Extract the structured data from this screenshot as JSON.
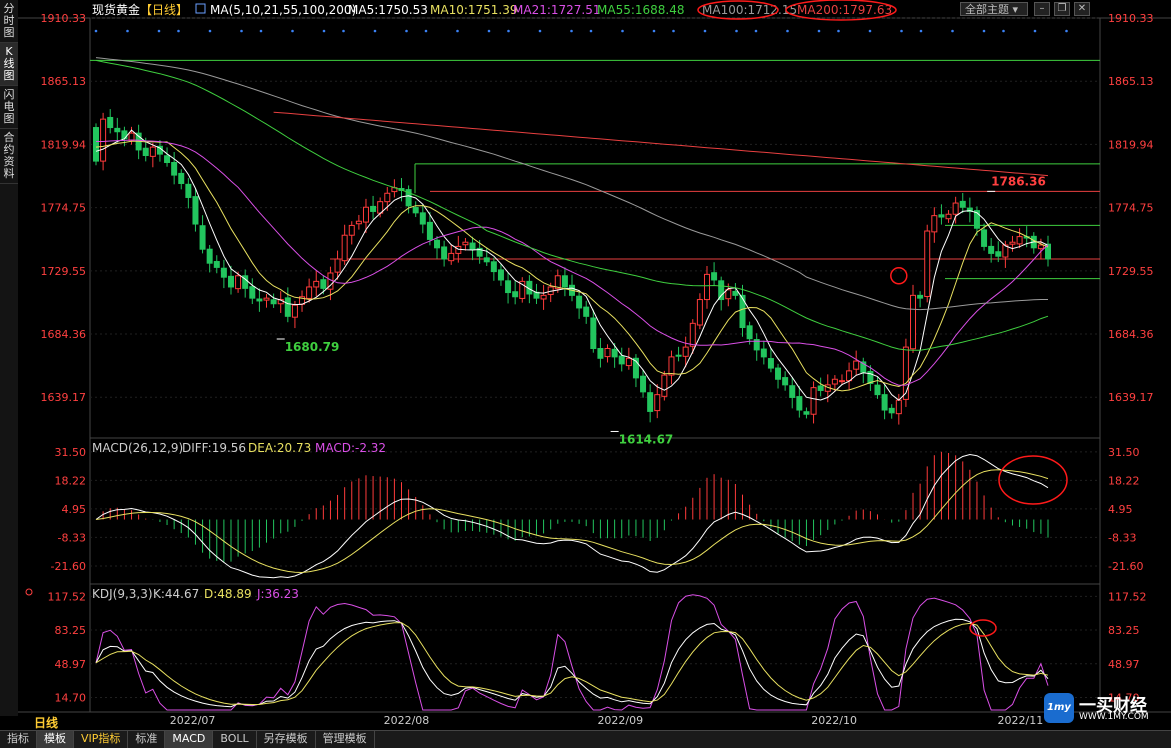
{
  "window": {
    "symbol": "现货黄金",
    "period_tag": "【日线】",
    "topic_button": "全部主题",
    "period_footer": "日线"
  },
  "left_tabs": [
    "分时图",
    "K线图",
    "闪电图",
    "合约资料"
  ],
  "bottom_tabs": [
    "指标",
    "模板",
    "VIP指标",
    "标准",
    "MACD",
    "BOLL",
    "另存模板",
    "管理模板"
  ],
  "logo": {
    "badge": "1my",
    "name": "一买财经",
    "url": "WWW.1MY.COM"
  },
  "colors": {
    "bg": "#000000",
    "up": "#ff3b3b",
    "down": "#22c55e",
    "ma5": "#ffffff",
    "ma10": "#e8e060",
    "ma21": "#d94fe6",
    "ma55": "#3fcf3f",
    "ma100": "#9a9a9a",
    "ma200": "#e84040",
    "axis_text": "#ff4040",
    "grid": "#202020",
    "highlight": "#ff1a1a"
  },
  "chart_data": [
    {
      "type": "candlestick",
      "panel": "price",
      "legend_prefix": "MA(5,10,21,55,100,200)",
      "ma_legend": [
        {
          "label": "MA5:1750.53",
          "color": "#ffffff"
        },
        {
          "label": "MA10:1751.39",
          "color": "#e8e060"
        },
        {
          "label": "MA21:1727.51",
          "color": "#d94fe6"
        },
        {
          "label": "MA55:1688.48",
          "color": "#3fcf3f"
        },
        {
          "label": "MA100:1712.15",
          "color": "#9a9a9a"
        },
        {
          "label": "MA200:1797.63",
          "color": "#e84040"
        }
      ],
      "y_ticks": [
        "1910.33",
        "1865.13",
        "1819.94",
        "1774.75",
        "1729.55",
        "1684.36",
        "1639.17"
      ],
      "ylim": [
        1610,
        1910.33
      ],
      "x_ticks": [
        "2022/07",
        "2022/08",
        "2022/09",
        "2022/10",
        "2022/11"
      ],
      "annotations": [
        {
          "label": "1680.79",
          "value": 1680.79,
          "color": "#3fcf3f"
        },
        {
          "label": "1614.67",
          "value": 1614.67,
          "color": "#3fcf3f"
        },
        {
          "label": "1786.36",
          "value": 1786.36,
          "color": "#ff4040"
        }
      ],
      "closes": [
        1808,
        1838,
        1832,
        1829,
        1824,
        1828,
        1816,
        1812,
        1818,
        1813,
        1807,
        1798,
        1792,
        1782,
        1763,
        1745,
        1735,
        1732,
        1725,
        1718,
        1726,
        1717,
        1710,
        1708,
        1710,
        1706,
        1709,
        1697,
        1705,
        1711,
        1718,
        1722,
        1717,
        1728,
        1738,
        1755,
        1762,
        1765,
        1775,
        1772,
        1779,
        1785,
        1789,
        1787,
        1776,
        1771,
        1763,
        1752,
        1746,
        1738,
        1742,
        1747,
        1750,
        1745,
        1740,
        1736,
        1729,
        1723,
        1714,
        1711,
        1722,
        1713,
        1710,
        1712,
        1718,
        1726,
        1718,
        1712,
        1703,
        1697,
        1674,
        1667,
        1674,
        1668,
        1663,
        1667,
        1653,
        1643,
        1629,
        1641,
        1655,
        1668,
        1669,
        1675,
        1692,
        1709,
        1727,
        1723,
        1709,
        1716,
        1712,
        1689,
        1681,
        1673,
        1668,
        1660,
        1652,
        1648,
        1639,
        1630,
        1627,
        1646,
        1644,
        1648,
        1652,
        1651,
        1658,
        1665,
        1657,
        1649,
        1641,
        1630,
        1628,
        1637,
        1675,
        1712,
        1710,
        1758,
        1769,
        1768,
        1770,
        1778,
        1775,
        1772,
        1760,
        1747,
        1742,
        1740,
        1748,
        1750,
        1754,
        1753,
        1746,
        1748,
        1738
      ],
      "ma_end_values": {
        "MA5": 1750.53,
        "MA10": 1751.39,
        "MA21": 1727.51,
        "MA55": 1688.48,
        "MA100": 1712.15,
        "MA200": 1797.63
      },
      "horizontal_lines": [
        1880,
        1806,
        1786.36,
        1762,
        1738,
        1724
      ]
    },
    {
      "type": "bar+line",
      "panel": "macd",
      "legend": [
        {
          "label": "MACD(26,12,9)",
          "color": "#cccccc"
        },
        {
          "label": "DIFF:19.56",
          "color": "#cccccc"
        },
        {
          "label": "DEA:20.73",
          "color": "#e8e060"
        },
        {
          "label": "MACD:-2.32",
          "color": "#d94fe6"
        }
      ],
      "y_ticks": [
        "31.50",
        "18.22",
        "4.95",
        "-8.33",
        "-21.60"
      ],
      "ylim": [
        -30,
        37
      ]
    },
    {
      "type": "line",
      "panel": "kdj",
      "legend": [
        {
          "label": "KDJ(9,3,3)",
          "color": "#cccccc"
        },
        {
          "label": "K:44.67",
          "color": "#cccccc"
        },
        {
          "label": "D:48.89",
          "color": "#e8e060"
        },
        {
          "label": "J:36.23",
          "color": "#d94fe6"
        }
      ],
      "y_ticks": [
        "117.52",
        "83.25",
        "48.97",
        "14.70"
      ],
      "ylim": [
        0,
        128
      ]
    }
  ]
}
